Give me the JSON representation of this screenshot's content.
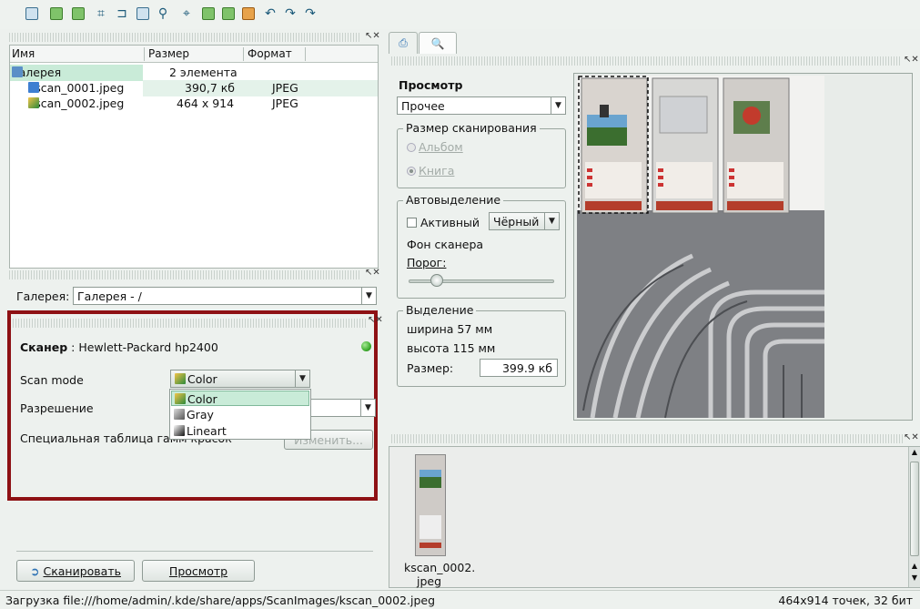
{
  "toolbar": {
    "icons": [
      "print-icon",
      "scan-icon",
      "scan-icon",
      "crop-icon",
      "mirror-icon",
      "zoom-fit-icon",
      "zoom-icon",
      "rotate-icon",
      "mirror-h-icon",
      "mirror-v-icon",
      "flip-icon",
      "undo-icon",
      "redo-icon",
      "redo2-icon"
    ]
  },
  "file_list": {
    "columns": [
      "Имя",
      "Размер",
      "Формат"
    ],
    "rows": [
      {
        "name": "Галерея",
        "size": "2 элемента",
        "format": ""
      },
      {
        "name": "kscan_0001.jpeg",
        "size": "390,7 кб",
        "format": "JPEG"
      },
      {
        "name": "kscan_0002.jpeg",
        "size": "464 x 914",
        "format": "JPEG"
      }
    ]
  },
  "gallery": {
    "label": "Галерея:",
    "value": "Галерея - /"
  },
  "scanner": {
    "label": "Сканер",
    "name": " : Hewlett-Packard hp2400",
    "scan_mode_label": "Scan mode",
    "scan_mode_value": "Color",
    "scan_mode_options": [
      "Color",
      "Gray",
      "Lineart"
    ],
    "resolution_label": "Разрешение",
    "gamma_label": "Специальная таблица гамм красок",
    "gamma_button": "Изменить..."
  },
  "buttons": {
    "scan": "Сканировать",
    "preview": "Просмотр"
  },
  "preview": {
    "title": "Просмотр",
    "preset": "Прочее",
    "scan_size_title": "Размер сканирования",
    "album": "Альбом",
    "book": "Книга",
    "autoselect_title": "Автовыделение",
    "active_label": "Активный",
    "color_value": "Чёрный",
    "scanner_bg": "Фон сканера",
    "threshold": "Порог:",
    "selection_title": "Выделение",
    "width": "ширина 57 мм",
    "height": "высота 115 мм",
    "size_label": "Размер:",
    "size_value": "399.9 кб"
  },
  "thumbnail": {
    "caption_line1": "kscan_0002.",
    "caption_line2": "jpeg"
  },
  "status": {
    "left": "Загрузка file:///home/admin/.kde/share/apps/ScanImages/kscan_0002.jpeg",
    "right": "464x914 точек, 32 бит"
  },
  "colors": {
    "highlight": "#9b0f12",
    "selection": "#c9ebd8",
    "led": "#3fae2f"
  }
}
